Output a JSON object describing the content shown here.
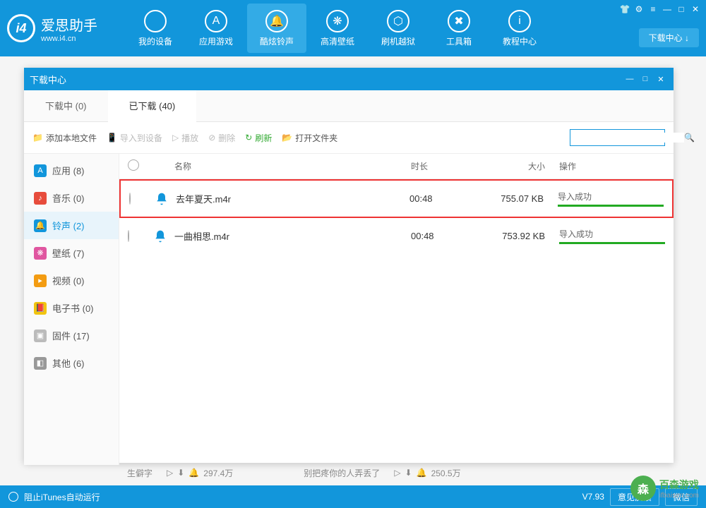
{
  "header": {
    "logo_badge": "i4",
    "title": "爱思助手",
    "subtitle": "www.i4.cn",
    "nav": [
      {
        "label": "我的设备",
        "icon": ""
      },
      {
        "label": "应用游戏",
        "icon": "A"
      },
      {
        "label": "酷炫铃声",
        "icon": "🔔",
        "active": true
      },
      {
        "label": "高清壁纸",
        "icon": "❋"
      },
      {
        "label": "刷机越狱",
        "icon": "⬡"
      },
      {
        "label": "工具箱",
        "icon": "✖"
      },
      {
        "label": "教程中心",
        "icon": "i"
      }
    ],
    "download_center_btn": "下载中心 ↓"
  },
  "modal": {
    "title": "下载中心",
    "tabs": [
      {
        "label": "下载中 (0)",
        "active": false
      },
      {
        "label": "已下载 (40)",
        "active": true
      }
    ],
    "toolbar": {
      "add_local": "添加本地文件",
      "import_device": "导入到设备",
      "play": "播放",
      "delete": "删除",
      "refresh": "刷新",
      "open_folder": "打开文件夹"
    },
    "sidebar": [
      {
        "label": "应用 (8)",
        "color": "#1296db",
        "icon": "A"
      },
      {
        "label": "音乐 (0)",
        "color": "#e74c3c",
        "icon": "♪"
      },
      {
        "label": "铃声 (2)",
        "color": "#1296db",
        "icon": "🔔",
        "active": true
      },
      {
        "label": "壁纸 (7)",
        "color": "#e056a0",
        "icon": "❋"
      },
      {
        "label": "视频 (0)",
        "color": "#f39c12",
        "icon": "▸"
      },
      {
        "label": "电子书 (0)",
        "color": "#f1c40f",
        "icon": "📕"
      },
      {
        "label": "固件 (17)",
        "color": "#bbb",
        "icon": "▣"
      },
      {
        "label": "其他 (6)",
        "color": "#999",
        "icon": "◧"
      }
    ],
    "columns": {
      "name": "名称",
      "duration": "时长",
      "size": "大小",
      "operation": "操作"
    },
    "rows": [
      {
        "name": "去年夏天.m4r",
        "duration": "00:48",
        "size": "755.07 KB",
        "status": "导入成功",
        "highlighted": true
      },
      {
        "name": "一曲相思.m4r",
        "duration": "00:48",
        "size": "753.92 KB",
        "status": "导入成功",
        "highlighted": false
      }
    ]
  },
  "bg_tracks": {
    "left_name": "生僻字",
    "left_count": "297.4万",
    "right_name": "别把疼你的人弄丢了",
    "right_count": "250.5万"
  },
  "statusbar": {
    "itunes": "阻止iTunes自动运行",
    "version": "V7.93",
    "feedback": "意见反馈",
    "wechat": "微信"
  },
  "watermark": {
    "main": "百森游戏",
    "sub": "ifbaisen.com",
    "badge": "森"
  }
}
